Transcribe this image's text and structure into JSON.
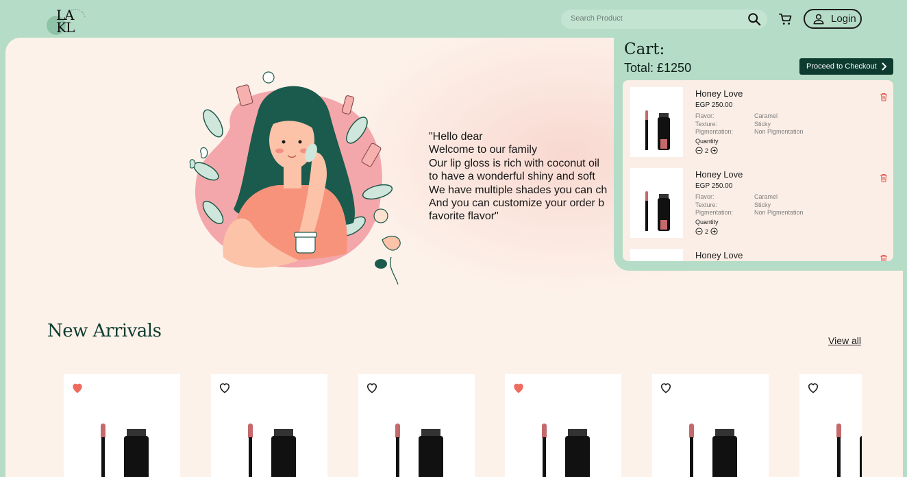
{
  "header": {
    "logo_text": "LAKL",
    "search_placeholder": "Search Product",
    "login_label": "Login"
  },
  "hero": {
    "welcome_text": "\"Hello dear\nWelcome to our family\nOur lip gloss is rich with coconut oil\nto have a wonderful shiny and soft\nWe have multiple shades you can ch\nAnd you can customize your order b\nfavorite flavor\""
  },
  "cart": {
    "title": "Cart:",
    "total": "Total: £1250",
    "checkout_label": "Proceed to Checkout",
    "items": [
      {
        "name": "Honey Love",
        "price": "EGP 250.00",
        "flavor_label": "Flavor:",
        "flavor": "Caramel",
        "texture_label": "Texture:",
        "texture": "Sticky",
        "pigment_label": "Pigmentation:",
        "pigment": "Non Pigmentation",
        "quantity_label": "Quantity",
        "quantity": "2"
      },
      {
        "name": "Honey Love",
        "price": "EGP 250.00",
        "flavor_label": "Flavor:",
        "flavor": "Caramel",
        "texture_label": "Texture:",
        "texture": "Sticky",
        "pigment_label": "Pigmentation:",
        "pigment": "Non Pigmentation",
        "quantity_label": "Quantity",
        "quantity": "2"
      },
      {
        "name": "Honey Love"
      }
    ]
  },
  "new_arrivals": {
    "title": "New Arrivals",
    "view_all": "View all",
    "products": [
      {
        "favorited": true
      },
      {
        "favorited": false
      },
      {
        "favorited": false
      },
      {
        "favorited": true
      },
      {
        "favorited": false
      },
      {
        "favorited": false
      }
    ]
  },
  "colors": {
    "mint_background": "#b5dcc6",
    "brand_dark_green": "#0e3b30",
    "cream": "#fdf2ea",
    "heart_red": "#ee6b5e",
    "trash_red": "#e2574c"
  },
  "icons": {
    "search": "search-icon",
    "cart": "cart-icon",
    "user": "user-icon",
    "heart": "heart-icon",
    "trash": "trash-icon",
    "chevron": "chevron-right-icon"
  }
}
